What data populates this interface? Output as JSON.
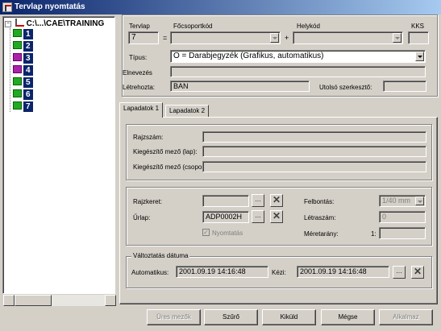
{
  "title": "Tervlap nyomtatás",
  "tree": {
    "root_label": "C:\\...\\CAE\\TRAINING",
    "items": [
      "1",
      "2",
      "3",
      "4",
      "5",
      "6",
      "7"
    ]
  },
  "header": {
    "tervlap_label": "Tervlap",
    "focsoport_label": "Főcsoportkód",
    "helykod_label": "Helykód",
    "kks_label": "KKS",
    "tervlap_value": "7",
    "eq": "=",
    "plus": "+",
    "tipus_label": "Típus:",
    "tipus_value": "O = Darabjegyzék  (Grafikus, automatikus)",
    "elnevezes_label": "Elnevezés",
    "letrehozta_label": "Létrehozta:",
    "letrehozta_value": "BAN",
    "utolso_label": "Utolsó szerkesztő:"
  },
  "tabs": [
    "Lapadatok 1",
    "Lapadatok 2"
  ],
  "lap": {
    "rajzszam_label": "Rajzszám:",
    "kieg_lap_label": "Kiegészítő mező (lap):",
    "kieg_csop_label": "Kiegészítő mező (csoport"
  },
  "print": {
    "rajzkeret_label": "Rajzkeret:",
    "urlap_label": "Űrlap:",
    "urlap_value": "ADP0002H",
    "nyomtatas_label": "Nyomtatás",
    "felbontas_label": "Felbontás:",
    "felbontas_value": "1/40 mm",
    "letraszam_label": "Létraszám:",
    "letraszam_value": "0",
    "meretarany_label": "Méretarány:",
    "meretarany_prefix": "1:"
  },
  "date": {
    "group_label": "Változtatás dátuma",
    "auto_label": "Automatikus:",
    "auto_value": "2001.09.19  14:16:48",
    "kezi_label": "Kézi:",
    "kezi_value": "2001.09.19  14:16:48"
  },
  "buttons": {
    "ures": "Üres mezők",
    "szuro": "Szűrő",
    "kikuld": "Kiküld",
    "megse": "Mégse",
    "alkalmaz": "Alkalmaz"
  }
}
